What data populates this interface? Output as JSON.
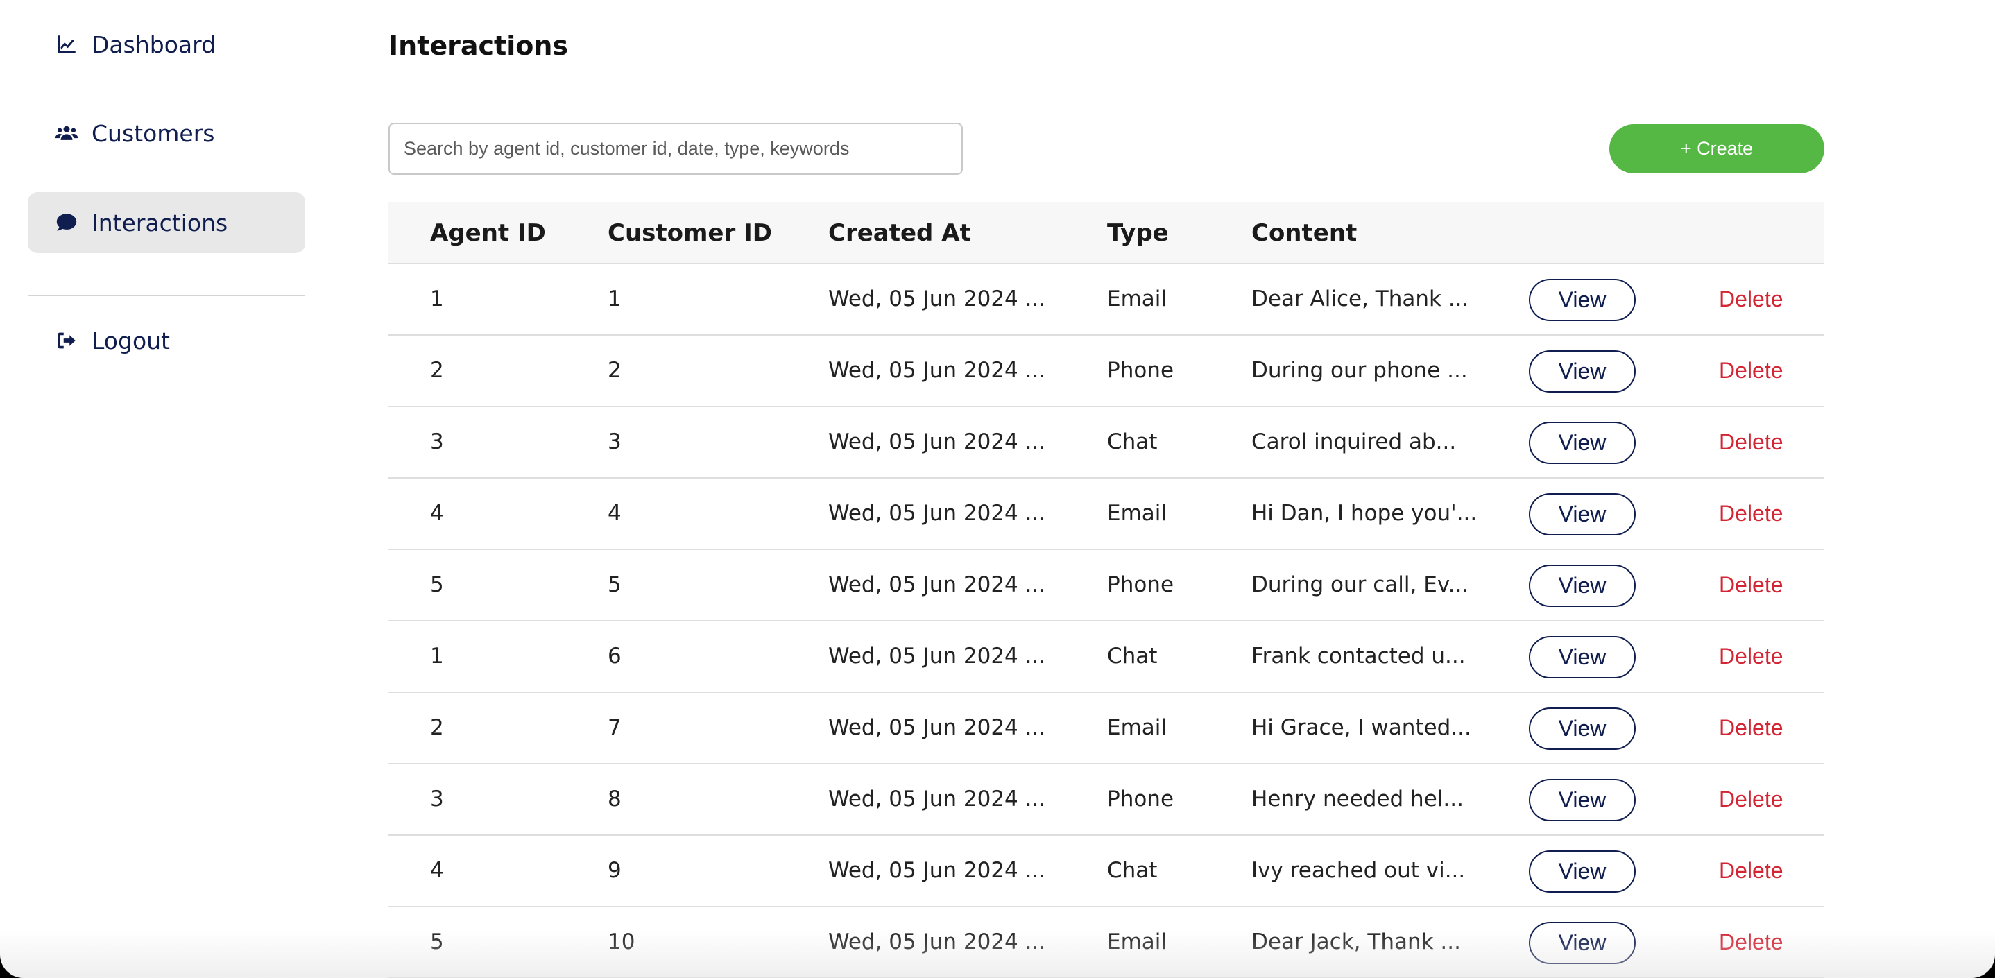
{
  "sidebar": {
    "items": [
      {
        "label": "Dashboard",
        "icon": "chart-line-icon"
      },
      {
        "label": "Customers",
        "icon": "users-icon"
      },
      {
        "label": "Interactions",
        "icon": "comment-icon",
        "active": true
      }
    ],
    "logout": {
      "label": "Logout",
      "icon": "sign-out-icon"
    }
  },
  "main": {
    "title": "Interactions",
    "search": {
      "placeholder": "Search by agent id, customer id, date, type, keywords",
      "value": ""
    },
    "create_label": "+ Create"
  },
  "table": {
    "columns": [
      "Agent ID",
      "Customer ID",
      "Created At",
      "Type",
      "Content"
    ],
    "view_label": "View",
    "delete_label": "Delete",
    "rows": [
      {
        "agent_id": "1",
        "customer_id": "1",
        "created_at": "Wed, 05 Jun 2024 ...",
        "type": "Email",
        "content": "Dear Alice, Thank ..."
      },
      {
        "agent_id": "2",
        "customer_id": "2",
        "created_at": "Wed, 05 Jun 2024 ...",
        "type": "Phone",
        "content": "During our phone ..."
      },
      {
        "agent_id": "3",
        "customer_id": "3",
        "created_at": "Wed, 05 Jun 2024 ...",
        "type": "Chat",
        "content": "Carol inquired ab..."
      },
      {
        "agent_id": "4",
        "customer_id": "4",
        "created_at": "Wed, 05 Jun 2024 ...",
        "type": "Email",
        "content": "Hi Dan, I hope you'..."
      },
      {
        "agent_id": "5",
        "customer_id": "5",
        "created_at": "Wed, 05 Jun 2024 ...",
        "type": "Phone",
        "content": "During our call, Ev..."
      },
      {
        "agent_id": "1",
        "customer_id": "6",
        "created_at": "Wed, 05 Jun 2024 ...",
        "type": "Chat",
        "content": "Frank contacted u..."
      },
      {
        "agent_id": "2",
        "customer_id": "7",
        "created_at": "Wed, 05 Jun 2024 ...",
        "type": "Email",
        "content": "Hi Grace, I wanted..."
      },
      {
        "agent_id": "3",
        "customer_id": "8",
        "created_at": "Wed, 05 Jun 2024 ...",
        "type": "Phone",
        "content": "Henry needed hel..."
      },
      {
        "agent_id": "4",
        "customer_id": "9",
        "created_at": "Wed, 05 Jun 2024 ...",
        "type": "Chat",
        "content": "Ivy reached out vi..."
      },
      {
        "agent_id": "5",
        "customer_id": "10",
        "created_at": "Wed, 05 Jun 2024 ...",
        "type": "Email",
        "content": "Dear Jack, Thank ..."
      }
    ]
  },
  "colors": {
    "accent": "#55b844",
    "nav": "#0f1d4f",
    "danger": "#d32634",
    "active_bg": "#e8e8e8"
  }
}
